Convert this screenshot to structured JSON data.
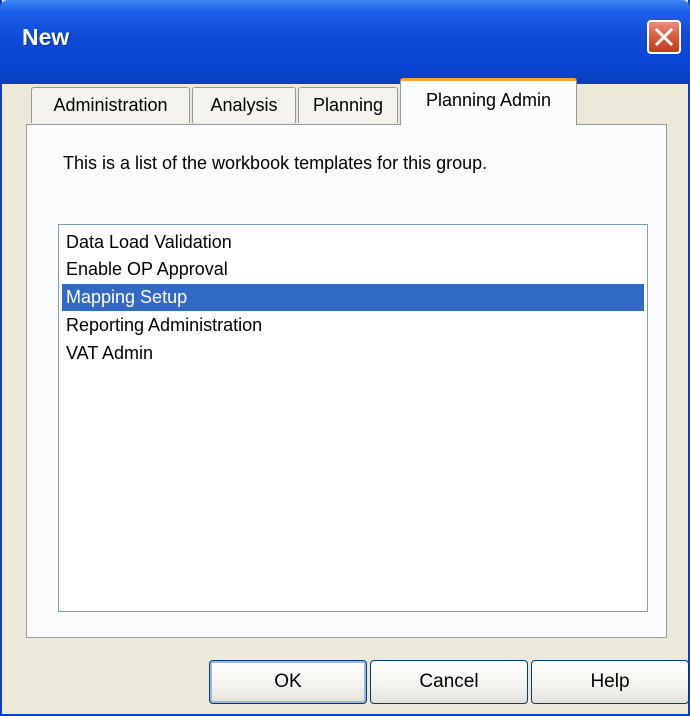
{
  "window": {
    "title": "New"
  },
  "tabs": [
    {
      "label": "Administration"
    },
    {
      "label": "Analysis"
    },
    {
      "label": "Planning"
    },
    {
      "label": "Planning Admin",
      "active": true
    }
  ],
  "panel": {
    "description": "This is a list of the workbook templates for this group."
  },
  "templates": {
    "items": [
      {
        "label": "Data Load Validation"
      },
      {
        "label": "Enable OP Approval"
      },
      {
        "label": "Mapping Setup",
        "selected": true
      },
      {
        "label": "Reporting Administration"
      },
      {
        "label": "VAT Admin"
      }
    ]
  },
  "buttons": {
    "ok": "OK",
    "cancel": "Cancel",
    "help": "Help"
  },
  "colors": {
    "title_bar": "#0a45d4",
    "selection": "#316ac5",
    "active_tab_accent": "#f9a432",
    "dialog_background": "#ece9d8"
  }
}
